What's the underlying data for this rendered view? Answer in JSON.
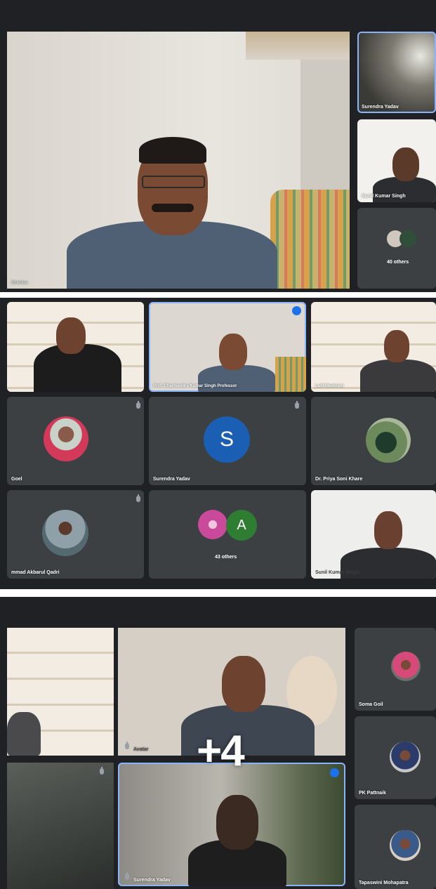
{
  "panel1": {
    "main_speaker": "Shankar",
    "thumb1": "Surendra Yadav",
    "thumb2": "Sunil Kumar Singh",
    "others": "40 others"
  },
  "panel2": {
    "pinned_speaker": "Prof. Dharmendra Kumar Singh Professor",
    "tile_top_right": "Lalit Meshram",
    "tile_goel": "Goel",
    "tile_s_avatar_letter": "S",
    "tile_s": "Surendra Yadav",
    "tile_priya": "Dr. Priya Soni Khare",
    "tile_akbarul": "mmad Akbarul Qadri",
    "tile_a_letter": "A",
    "others": "43 others",
    "tile_bottom_right": "Sunil Kumar Singh",
    "colors": {
      "s_avatar": "#1a5fb4",
      "a_avatar": "#2e7d32",
      "active_border": "#8ab4f8"
    }
  },
  "panel3": {
    "tile_center": "Avatar",
    "tile_bottom_center": "Surendra Yadav",
    "right1": "Soma Goil",
    "right2": "PK Pattnaik",
    "right3": "Tapaswini Mohapatra",
    "overlay": "+4"
  }
}
